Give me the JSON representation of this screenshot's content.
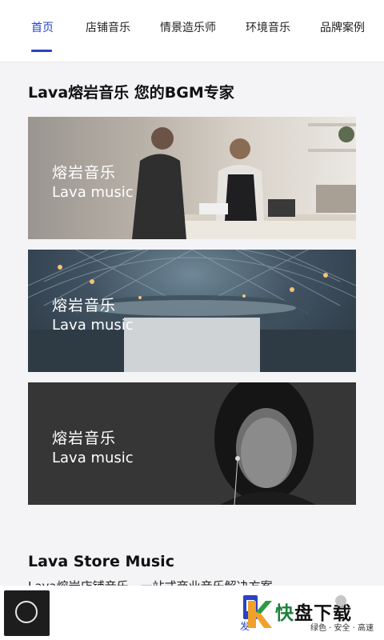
{
  "tabs": [
    {
      "label": "首页",
      "active": true
    },
    {
      "label": "店铺音乐",
      "active": false
    },
    {
      "label": "情景造乐师",
      "active": false
    },
    {
      "label": "环境音乐",
      "active": false
    },
    {
      "label": "品牌案例",
      "active": false
    }
  ],
  "heading": "Lava熔岩音乐 您的BGM专家",
  "banners": [
    {
      "title_cn": "熔岩音乐",
      "title_en": "Lava music"
    },
    {
      "title_cn": "熔岩音乐",
      "title_en": "Lava music"
    },
    {
      "title_cn": "熔岩音乐",
      "title_en": "Lava music"
    }
  ],
  "store_heading": "Lava Store Music",
  "store_subtitle": "Lava熔岩店铺音乐，一站式商业音乐解决方案",
  "bottom": {
    "badge_text": "发",
    "logo_main_green": "快",
    "logo_main_black": "盘下载",
    "logo_sub": "绿色 · 安全 · 高速"
  },
  "colors": {
    "accent": "#2743c5",
    "logo_green": "#1d7f3a"
  }
}
